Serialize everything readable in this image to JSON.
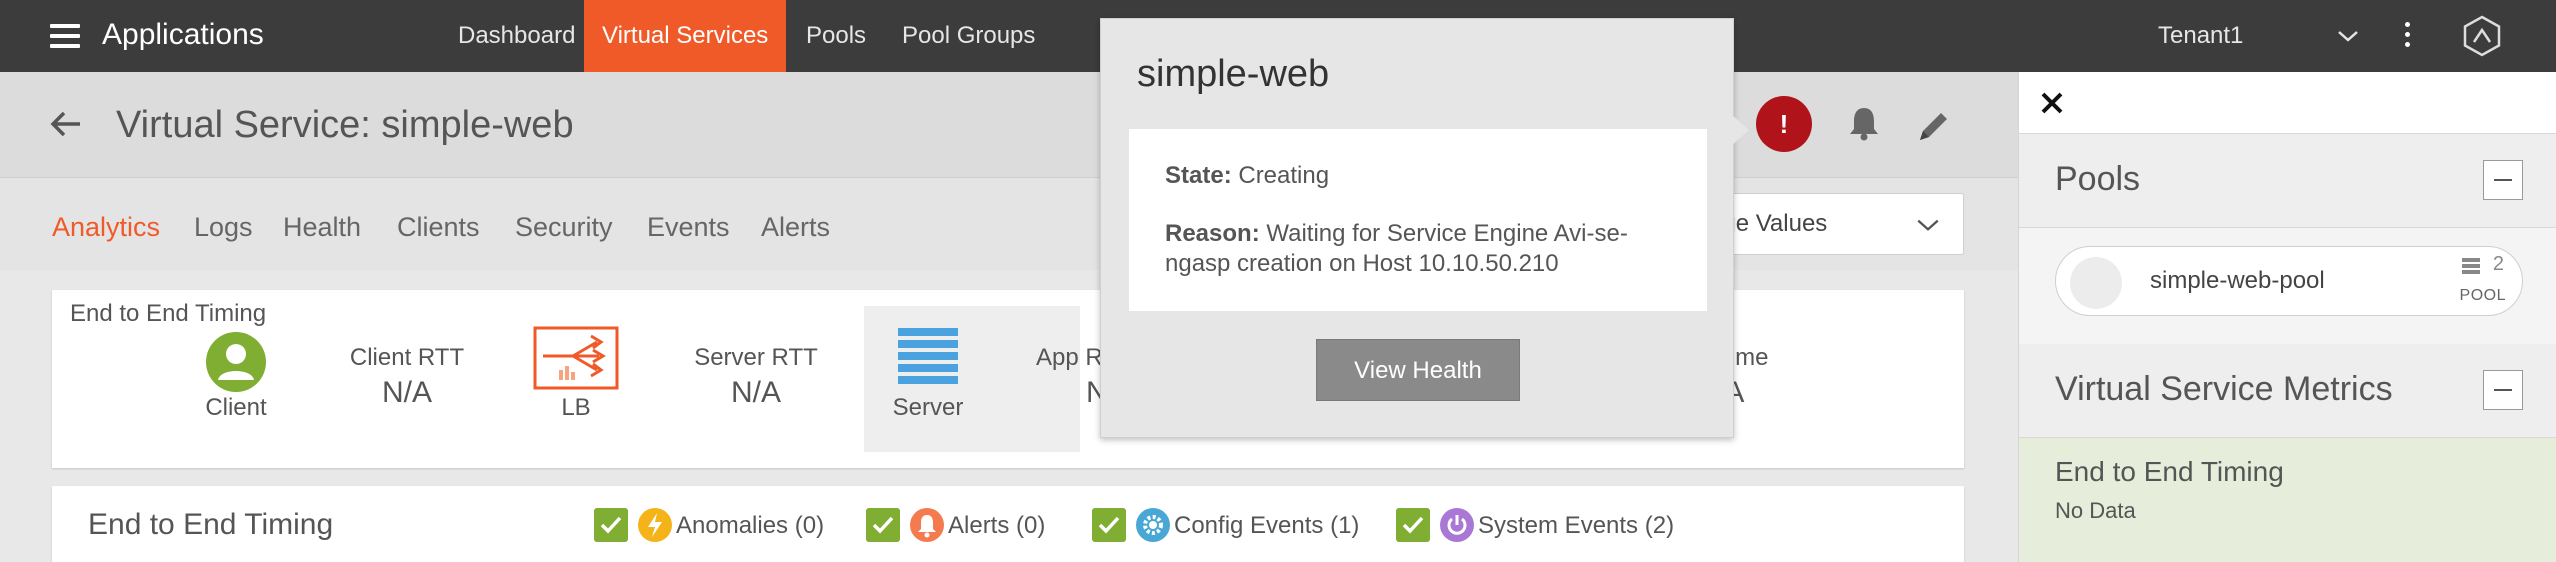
{
  "nav": {
    "app_title": "Applications",
    "items": [
      "Dashboard",
      "Virtual Services",
      "Pools",
      "Pool Groups"
    ],
    "active_index": 1,
    "tenant": "Tenant1"
  },
  "header": {
    "title": "Virtual Service:  simple-web",
    "alert_badge": "!",
    "select_value": "rage Values"
  },
  "tabs": [
    "Analytics",
    "Logs",
    "Health",
    "Clients",
    "Security",
    "Events",
    "Alerts"
  ],
  "timing": {
    "heading": "End to End Timing",
    "client_label": "Client",
    "client_rtt_label": "Client RTT",
    "client_rtt_value": "N/A",
    "lb_label": "LB",
    "server_rtt_label": "Server RTT",
    "server_rtt_value": "N/A",
    "server_label": "Server",
    "app_label_partial": "App R",
    "app_value_partial": "N",
    "total_label_partial": "Time",
    "total_value_partial": "/A"
  },
  "events_bar": {
    "title": "End to End Timing",
    "items": [
      {
        "label": "Anomalies (0)",
        "color": "#f5b31a",
        "icon": "lightning-icon"
      },
      {
        "label": "Alerts (0)",
        "color": "#f47b4f",
        "icon": "bell-icon"
      },
      {
        "label": "Config Events (1)",
        "color": "#49a7d6",
        "icon": "gear-icon"
      },
      {
        "label": "System Events (2)",
        "color": "#a977d6",
        "icon": "power-icon"
      }
    ]
  },
  "popover": {
    "title": "simple-web",
    "state_label": "State:",
    "state_value": "Creating",
    "reason_label": "Reason:",
    "reason_value_line1": "Waiting for Service Engine Avi-se-",
    "reason_value_line2": "ngasp creation on Host 10.10.50.210",
    "button": "View Health"
  },
  "sidebar": {
    "pools_title": "Pools",
    "pool_name": "simple-web-pool",
    "pool_count": "2",
    "pool_kind": "POOL",
    "metrics_title": "Virtual Service Metrics",
    "metric_name": "End to End Timing",
    "metric_value": "No Data"
  },
  "colors": {
    "accent": "#f05a28",
    "nav_bg": "#3c3c3c",
    "alert_red": "#b0141a",
    "check_green": "#7fae33"
  }
}
